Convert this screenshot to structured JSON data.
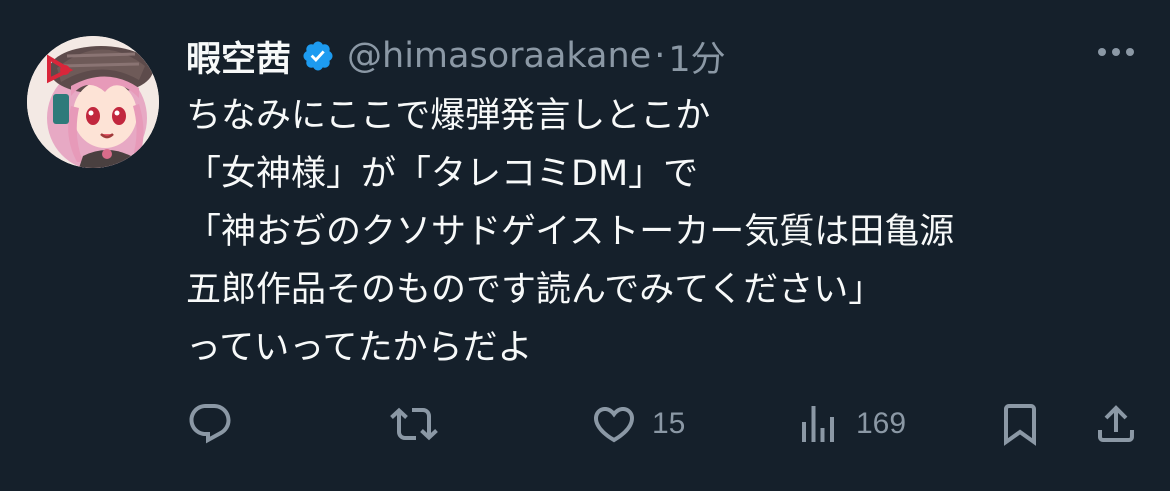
{
  "tweet": {
    "author": {
      "display_name": "暇空茜",
      "handle": "@himasoraakane",
      "verified": true
    },
    "separator": "·",
    "time": "1分",
    "text_lines": [
      "ちなみにここで爆弾発言しとこか",
      "「女神様」が「タレコミDM」で",
      "「神おぢのクソサドゲイストーカー気質は田亀源",
      "五郎作品そのものです読んでみてください」",
      "っていってたからだよ"
    ],
    "actions": {
      "reply": {
        "icon": "reply-icon",
        "count": ""
      },
      "retweet": {
        "icon": "retweet-icon",
        "count": ""
      },
      "like": {
        "icon": "heart-icon",
        "count": "15"
      },
      "views": {
        "icon": "views-icon",
        "count": "169"
      },
      "bookmark": {
        "icon": "bookmark-icon"
      },
      "share": {
        "icon": "share-icon"
      }
    }
  },
  "colors": {
    "background": "#15202b",
    "text": "#f7f9f9",
    "secondary": "#8b98a5",
    "verified": "#1d9bf0"
  }
}
